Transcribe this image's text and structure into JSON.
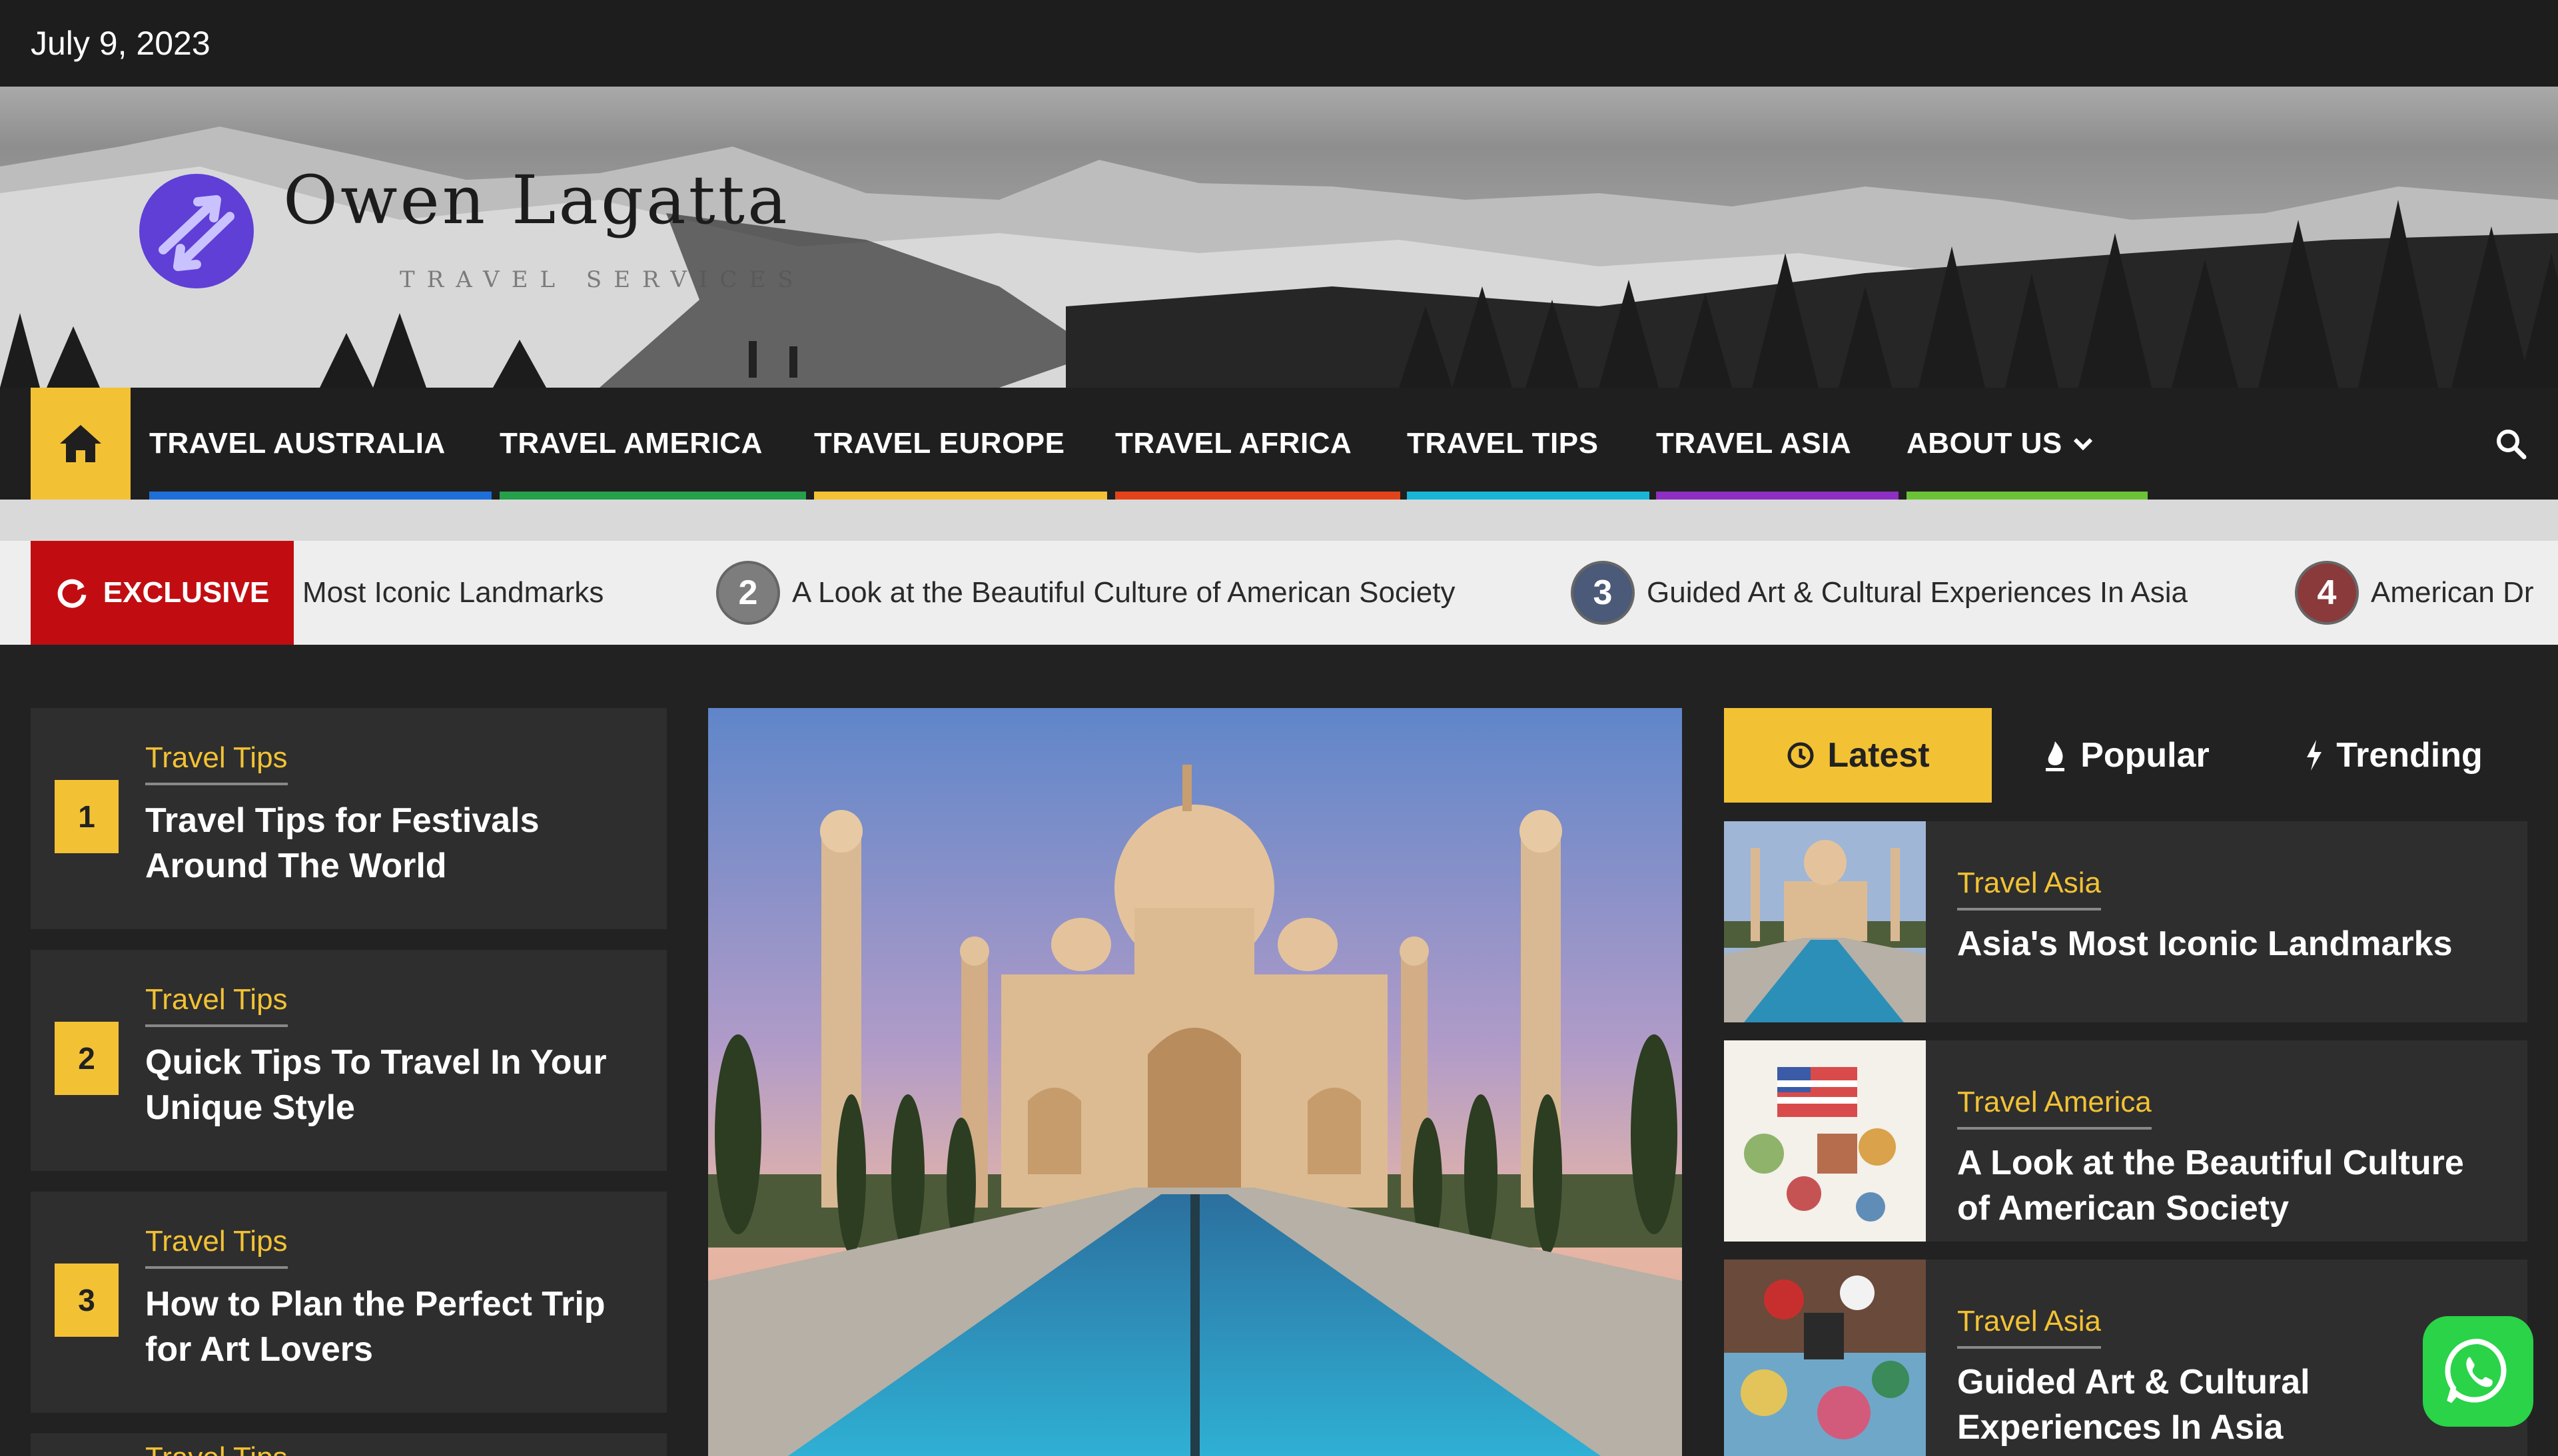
{
  "topbar": {
    "date": "July 9, 2023"
  },
  "brand": {
    "name": "Owen Lagatta",
    "tagline": "TRAVEL SERVICES",
    "colors": {
      "logo": "#5f3fd6"
    }
  },
  "nav": {
    "home_icon": "home-icon",
    "items": [
      {
        "label": "TRAVEL AUSTRALIA",
        "color": "#1e6fd9"
      },
      {
        "label": "TRAVEL AMERICA",
        "color": "#26a04a"
      },
      {
        "label": "TRAVEL EUROPE",
        "color": "#f3c234"
      },
      {
        "label": "TRAVEL AFRICA",
        "color": "#e2431a"
      },
      {
        "label": "TRAVEL TIPS",
        "color": "#18b6d6"
      },
      {
        "label": "TRAVEL ASIA",
        "color": "#8d2fc2"
      },
      {
        "label": "ABOUT US",
        "color": "#6cc236"
      }
    ],
    "search_icon": "search-icon"
  },
  "ticker": {
    "label": "EXCLUSIVE",
    "items": [
      {
        "num": "",
        "text": "Most Iconic Landmarks"
      },
      {
        "num": "2",
        "text": "A Look at the Beautiful Culture of American Society"
      },
      {
        "num": "3",
        "text": "Guided Art & Cultural Experiences In Asia"
      },
      {
        "num": "4",
        "text": "American Dr"
      }
    ]
  },
  "left_list": [
    {
      "rank": "1",
      "category": "Travel Tips",
      "title": "Travel Tips for Festivals Around The World"
    },
    {
      "rank": "2",
      "category": "Travel Tips",
      "title": "Quick Tips To Travel In Your Unique Style"
    },
    {
      "rank": "3",
      "category": "Travel Tips",
      "title": "How to Plan the Perfect Trip for Art Lovers"
    },
    {
      "rank": "",
      "category": "Travel Tips",
      "title": ""
    }
  ],
  "tabs": [
    {
      "label": "Latest",
      "icon": "clock-icon"
    },
    {
      "label": "Popular",
      "icon": "flame-icon"
    },
    {
      "label": "Trending",
      "icon": "bolt-icon"
    }
  ],
  "right_list": [
    {
      "category": "Travel Asia",
      "title": "Asia's Most Iconic Landmarks"
    },
    {
      "category": "Travel America",
      "title": "A Look at the Beautiful Culture of American Society"
    },
    {
      "category": "Travel Asia",
      "title": "Guided Art & Cultural Experiences In Asia"
    }
  ]
}
